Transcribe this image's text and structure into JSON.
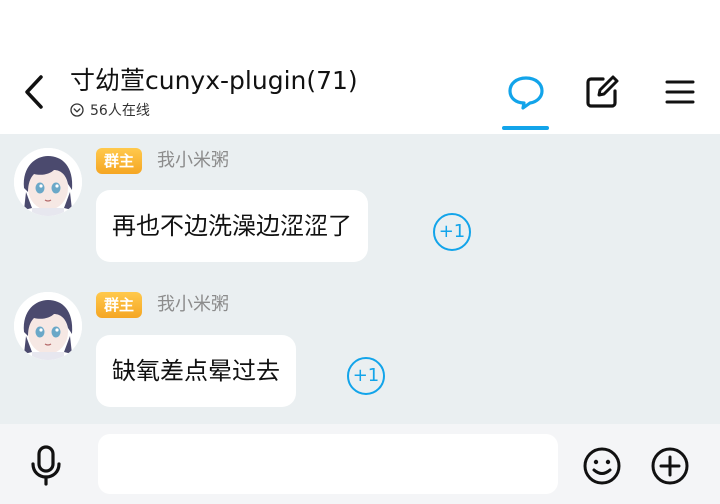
{
  "header": {
    "title": "寸幼萱cunyx-plugin(71)",
    "online_count": "56人在线",
    "back_icon": "chevron-left-icon",
    "chat_icon": "chat-bubble-icon",
    "edit_icon": "edit-square-icon",
    "menu_icon": "hamburger-menu-icon",
    "accent": "#12a4ea"
  },
  "messages": [
    {
      "badge": "群主",
      "sender": "我小米粥",
      "text": "再也不边洗澡边涩涩了",
      "plus_one": "+1"
    },
    {
      "badge": "群主",
      "sender": "我小米粥",
      "text": "缺氧差点晕过去",
      "plus_one": "+1"
    }
  ],
  "input_bar": {
    "mic_icon": "microphone-icon",
    "placeholder": "",
    "emoji_icon": "smiley-icon",
    "plus_icon": "plus-circle-icon"
  },
  "colors": {
    "chat_background": "#eaeff1",
    "badge": "#f5a623"
  }
}
